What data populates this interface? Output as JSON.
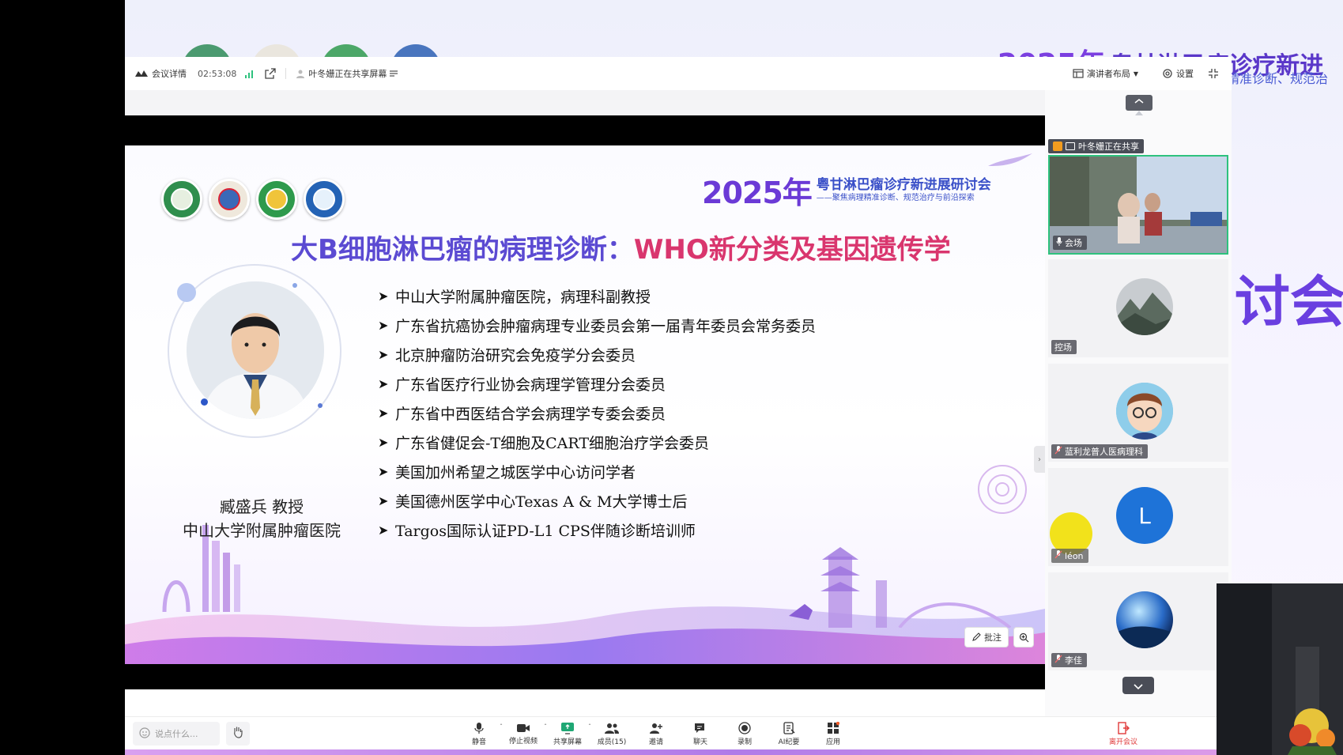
{
  "background": {
    "banner_year": "2025年",
    "banner_title": "粤甘淋巴瘤诊疗新进",
    "banner_subtitle": "精准诊断、规范治",
    "side_text": "讨会"
  },
  "topbar": {
    "meeting_details": "会议详情",
    "elapsed_time": "02:53:08",
    "sharing_notice": "叶冬姗正在共享屏幕",
    "layout_label": "演讲者布局",
    "settings_label": "设置"
  },
  "slide": {
    "conf_year": "2025年",
    "conf_title": "粤甘淋巴瘤诊疗新进展研讨会",
    "conf_subtitle": "——聚焦病理精准诊断、规范治疗与前沿探索",
    "title_part1": "大B细胞淋巴瘤的病理诊断：",
    "title_part2": "WHO新分类及基因遗传学",
    "speaker_name": "臧盛兵 教授",
    "speaker_affiliation": "中山大学附属肿瘤医院",
    "bullets": [
      "中山大学附属肿瘤医院，病理科副教授",
      "广东省抗癌协会肿瘤病理专业委员会第一届青年委员会常务委员",
      "北京肿瘤防治研究会免疫学分会委员",
      "广东省医疗行业协会病理学管理分会委员",
      "广东省中西医结合学会病理学专委会委员",
      "广东省健促会-T细胞及CART细胞治疗学会委员",
      "美国加州希望之城医学中心访问学者",
      "美国德州医学中心Texas A & M大学博士后",
      "Targos国际认证PD-L1 CPS伴随诊断培训师"
    ]
  },
  "annotation": {
    "annotate_label": "批注"
  },
  "participants": [
    {
      "name": "叶冬姗正在共享",
      "kind": "sharing-banner"
    },
    {
      "name": "会场",
      "kind": "video"
    },
    {
      "name": "控场",
      "kind": "avatar-landscape"
    },
    {
      "name": "蓝利龙普人医病理科",
      "kind": "avatar-cartoon"
    },
    {
      "name": "léon",
      "kind": "avatar-letter",
      "letter": "L"
    },
    {
      "name": "李佳",
      "kind": "avatar-earth"
    }
  ],
  "toolbar": {
    "chat_placeholder": "说点什么...",
    "tools": [
      "静音",
      "停止视频",
      "共享屏幕",
      "成员(15)",
      "邀请",
      "聊天",
      "录制",
      "AI纪要",
      "应用"
    ],
    "leave_label": "离开会议"
  },
  "colors": {
    "accent_purple": "#5b4ad2",
    "accent_pink": "#d9366e",
    "active_green": "#2ec27e",
    "leave_red": "#e03a3a"
  }
}
